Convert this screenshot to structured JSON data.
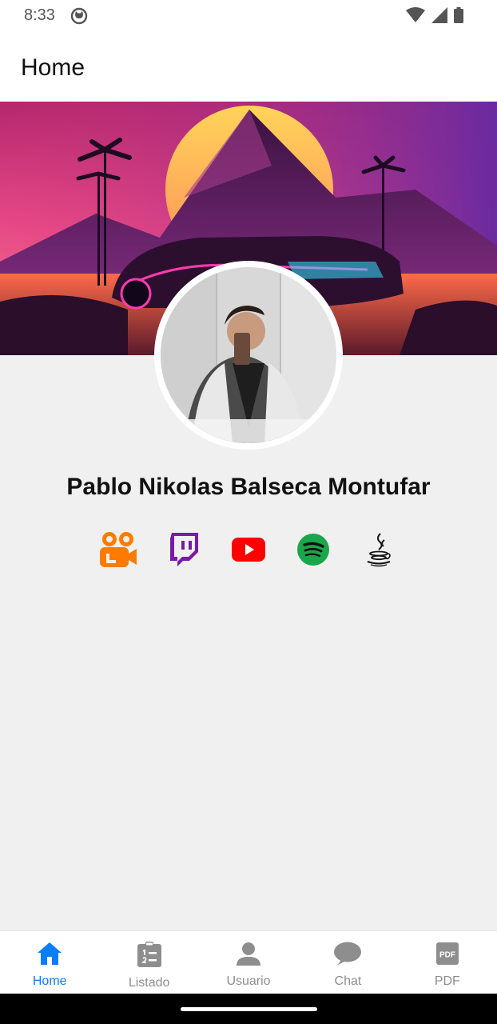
{
  "status_bar": {
    "time": "8:33",
    "icons": [
      "github-icon",
      "wifi-icon",
      "signal-icon",
      "battery-icon"
    ]
  },
  "app_bar": {
    "title": "Home"
  },
  "cover": {
    "description_icon": "synthwave-cover-image"
  },
  "profile": {
    "name": "Pablo Nikolas Balseca Montufar",
    "socials": [
      {
        "name": "kuaishou-icon",
        "color": "#ff7a00"
      },
      {
        "name": "twitch-icon",
        "color": "#7a1aa8"
      },
      {
        "name": "youtube-icon",
        "color": "#ff0000"
      },
      {
        "name": "spotify-icon",
        "color": "#1aa64a"
      },
      {
        "name": "java-icon",
        "color": "#111111"
      }
    ]
  },
  "bottom_nav": {
    "items": [
      {
        "label": "Home",
        "icon": "home-icon",
        "active": true
      },
      {
        "label": "Listado",
        "icon": "clipboard-list-icon",
        "active": false
      },
      {
        "label": "Usuario",
        "icon": "user-icon",
        "active": false
      },
      {
        "label": "Chat",
        "icon": "chat-bubble-icon",
        "active": false
      },
      {
        "label": "PDF",
        "icon": "pdf-icon",
        "active": false
      }
    ],
    "active_color": "#0a7ef7",
    "inactive_color": "#8e8e8e"
  }
}
